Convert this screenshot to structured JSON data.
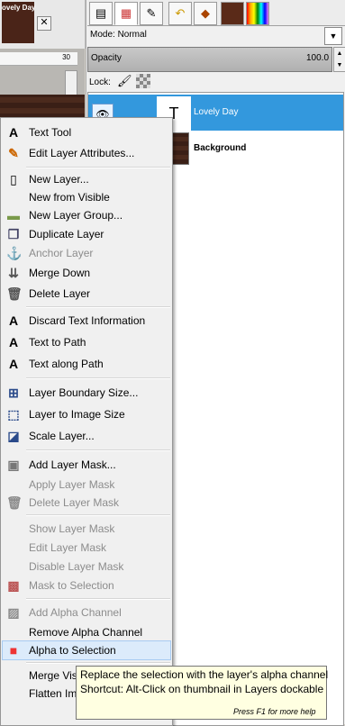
{
  "image_tab": {
    "thumb_title": "ovely Day",
    "close_glyph": "✕"
  },
  "ruler": {
    "tick_label": "30"
  },
  "dock": {
    "tabs": [
      "tool-options-icon",
      "layers-icon",
      "paths-icon",
      "undo-icon",
      "channels-icon",
      "brushes-icon",
      "gradients-icon"
    ],
    "mode_label": "Mode: Normal",
    "opacity_label": "Opacity",
    "opacity_value": "100.0",
    "lock_label": "Lock:",
    "layers": [
      {
        "name": "Lovely Day",
        "selected": true,
        "visible": true
      },
      {
        "name": "Background",
        "selected": false,
        "visible": false
      }
    ]
  },
  "menu": {
    "items": [
      {
        "label": "Text Tool",
        "icon": "text-A-icon",
        "disabled": false
      },
      {
        "label": "Edit Layer Attributes...",
        "icon": "edit-attributes-icon",
        "disabled": false
      },
      {
        "label": "New Layer...",
        "icon": "new-layer-icon",
        "disabled": false
      },
      {
        "label": "New from Visible",
        "icon": "",
        "disabled": false
      },
      {
        "label": "New Layer Group...",
        "icon": "folder-icon",
        "disabled": false
      },
      {
        "label": "Duplicate Layer",
        "icon": "duplicate-icon",
        "disabled": false
      },
      {
        "label": "Anchor Layer",
        "icon": "anchor-icon",
        "disabled": true
      },
      {
        "label": "Merge Down",
        "icon": "merge-down-icon",
        "disabled": false
      },
      {
        "label": "Delete Layer",
        "icon": "trash-icon",
        "disabled": false
      },
      {
        "label": "Discard Text Information",
        "icon": "text-A-icon",
        "disabled": false
      },
      {
        "label": "Text to Path",
        "icon": "text-A-icon",
        "disabled": false
      },
      {
        "label": "Text along Path",
        "icon": "text-A-icon",
        "disabled": false
      },
      {
        "label": "Layer Boundary Size...",
        "icon": "boundary-size-icon",
        "disabled": false
      },
      {
        "label": "Layer to Image Size",
        "icon": "image-size-icon",
        "disabled": false
      },
      {
        "label": "Scale Layer...",
        "icon": "scale-icon",
        "disabled": false
      },
      {
        "label": "Add Layer Mask...",
        "icon": "add-mask-icon",
        "disabled": false
      },
      {
        "label": "Apply Layer Mask",
        "icon": "",
        "disabled": true
      },
      {
        "label": "Delete Layer Mask",
        "icon": "trash-icon",
        "disabled": true
      },
      {
        "label": "Show Layer Mask",
        "icon": "",
        "disabled": true
      },
      {
        "label": "Edit Layer Mask",
        "icon": "",
        "disabled": true
      },
      {
        "label": "Disable Layer Mask",
        "icon": "",
        "disabled": true
      },
      {
        "label": "Mask to Selection",
        "icon": "mask-selection-icon",
        "disabled": true
      },
      {
        "label": "Add Alpha Channel",
        "icon": "alpha-channel-icon",
        "disabled": true
      },
      {
        "label": "Remove Alpha Channel",
        "icon": "",
        "disabled": false
      },
      {
        "label": "Alpha to Selection",
        "icon": "alpha-selection-icon",
        "disabled": false
      },
      {
        "label": "Merge Vis",
        "icon": "",
        "disabled": false
      },
      {
        "label": "Flatten Im",
        "icon": "",
        "disabled": false
      }
    ]
  },
  "tooltip": {
    "line1": "Replace the selection with the layer's alpha channel",
    "line2": "Shortcut: Alt-Click on thumbnail in Layers dockable",
    "hint": "Press F1 for more help"
  },
  "colors": {
    "selection_blue": "#3398dd",
    "tooltip_bg": "#ffffe1",
    "menu_highlight": "#dcebfb"
  }
}
